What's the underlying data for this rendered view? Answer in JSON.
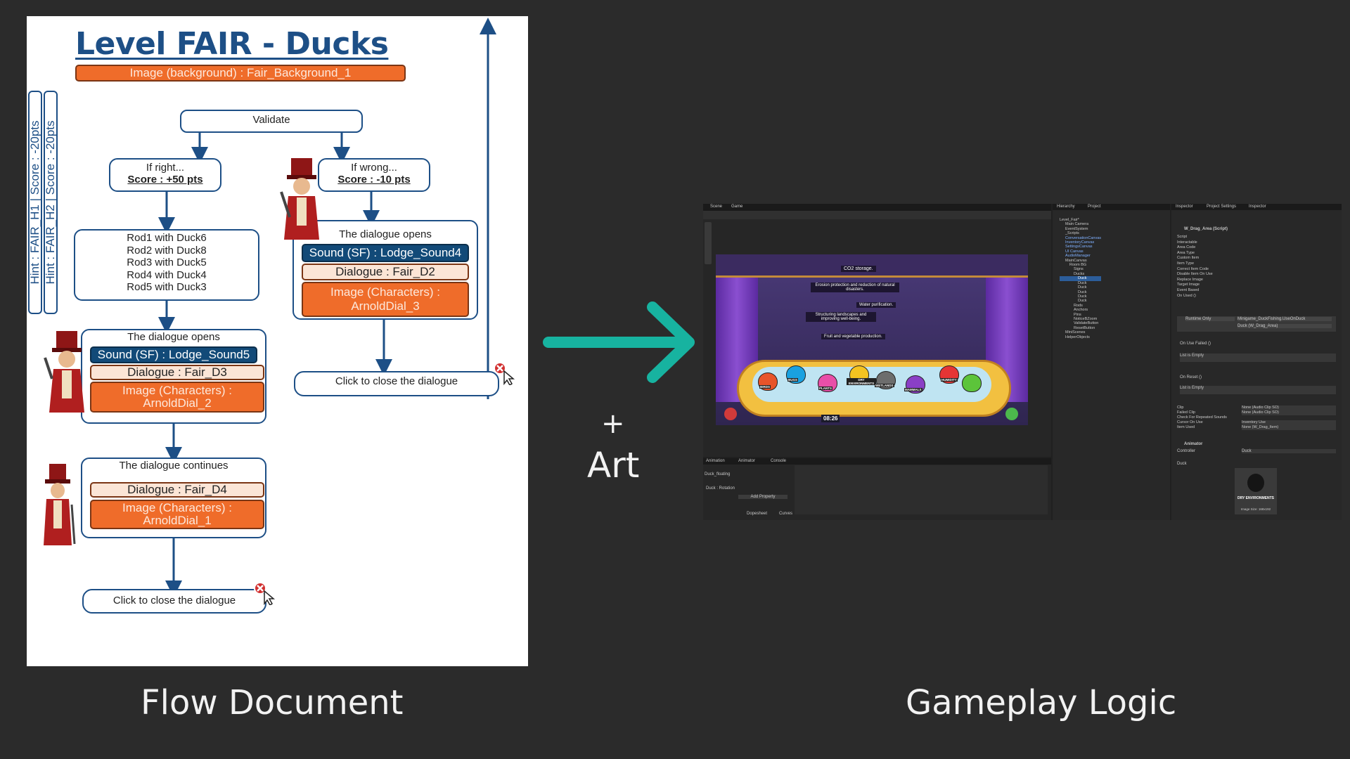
{
  "document": {
    "title": "Level FAIR - Ducks",
    "background_image": "Image (background) : Fair_Background_1",
    "hints": [
      "Hint : FAIR_H1 | Score : -20pts",
      "Hint : FAIR_H2 | Score : -20pts"
    ],
    "validate": "Validate",
    "right": {
      "line1": "If right...",
      "line2": "Score : +50 pts"
    },
    "wrong": {
      "line1": "If wrong...",
      "line2": "Score : -10 pts"
    },
    "pairs": [
      "Rod1 with Duck6",
      "Rod2 with Duck8",
      "Rod3 with Duck5",
      "Rod4 with Duck4",
      "Rod5 with Duck3"
    ],
    "dialogue_right": {
      "title": "The dialogue opens",
      "sound": "Sound (SF) : Lodge_Sound5",
      "dialogue": "Dialogue : Fair_D3",
      "image": "Image (Characters) : ArnoldDial_2"
    },
    "dialogue_continue": {
      "title": "The dialogue continues",
      "dialogue": "Dialogue : Fair_D4",
      "image": "Image (Characters) : ArnoldDial_1"
    },
    "dialogue_wrong": {
      "title": "The dialogue opens",
      "sound": "Sound (SF) : Lodge_Sound4",
      "dialogue": "Dialogue : Fair_D2",
      "image": "Image (Characters) : ArnoldDial_3"
    },
    "close_left": "Click to close the dialogue",
    "close_right": "Click to close the dialogue"
  },
  "middle": {
    "plus": "+",
    "art": "Art"
  },
  "captions": {
    "left": "Flow Document",
    "right": "Gameplay Logic"
  },
  "editor": {
    "tabs": [
      "Scene",
      "Game"
    ],
    "hierarchy_tabs": [
      "Hierarchy",
      "Project"
    ],
    "inspector_tabs": [
      "Inspector",
      "Project Settings",
      "Inspector"
    ],
    "bottom_tabs": [
      "Animation",
      "Animator",
      "Console"
    ],
    "hierarchy_items": [
      "Level_Fair*",
      "Main Camera",
      "EventSystem",
      "_Scripts",
      "ConversationCanvas",
      "InventoryCanvas",
      "SettingsCanvas",
      "UI Canvas",
      "AudioManager",
      "MainCanvas",
      "Room BG",
      "Signs",
      "Ducks",
      "Duck",
      "Duck",
      "Duck",
      "Duck",
      "Duck",
      "Duck",
      "Rods",
      "Anchors",
      "Pins",
      "NoticeBZoom",
      "ValidateButton",
      "ResetButton",
      "MiniScenes",
      "HelperObjects"
    ],
    "component_title": "W_Drag_Area (Script)",
    "inspector_rows": [
      "Script",
      "Interactable",
      "Area Code",
      "Area Type",
      "Custom Item",
      "Item Type",
      "Correct Item Code",
      "Disable Item On Use",
      "Replace Image",
      "Target Image",
      "Event Based",
      "On Used ()"
    ],
    "runtime": "Runtime Only",
    "method": "Minigame_DuckFishing.UseOnDuck",
    "drag_area": "Duck (W_Drag_Area)",
    "on_use_failed": "On Use Failed ()",
    "list_empty": "List is Empty",
    "on_reset": "On Reset ()",
    "clip_rows": [
      "Clip",
      "Failed Clip",
      "Check For Repeated Sounds",
      "Cursor On Use",
      "Item Used"
    ],
    "clip_values": [
      "None (Audio Clip SO)",
      "None (Audio Clip SO)",
      "",
      "Inventory Use",
      "None (W_Drag_Item)"
    ],
    "animator": "Animator",
    "controller": "Controller",
    "controller_value": "Duck",
    "preview_label": "Duck",
    "preview_text": "DRY ENVIRONMENTS",
    "preview_size": "Image Size: 168x192",
    "anim_clip": "Duck_floating",
    "anim_property": "Duck : Rotation",
    "add_property": "Add Property",
    "dopesheet": "Dopesheet",
    "curves": "Curves",
    "game": {
      "signs": [
        "CO2 storage.",
        "Erosion protection and reduction of natural disasters.",
        "Water purification.",
        "Structuring landscapes and improving well-being.",
        "Fruit and vegetable production."
      ],
      "ducks": [
        "BIRDS",
        "BUGS",
        "PLANTS",
        "DRY ENVIRONMENTS",
        "WETLANDS",
        "MAMMALS",
        "HUMIDITY"
      ],
      "duck_colors": [
        "#e8542a",
        "#1aa1e0",
        "#e84fa8",
        "#f4c320",
        "#6d6d6d",
        "#8a3fc6",
        "#e63535",
        "#5cc43a"
      ],
      "timer": "08:26"
    }
  },
  "colors": {
    "navy": "#1d4f86",
    "orange": "#ef6c2a",
    "teal": "#17b3a0",
    "background": "#2b2b2b"
  }
}
